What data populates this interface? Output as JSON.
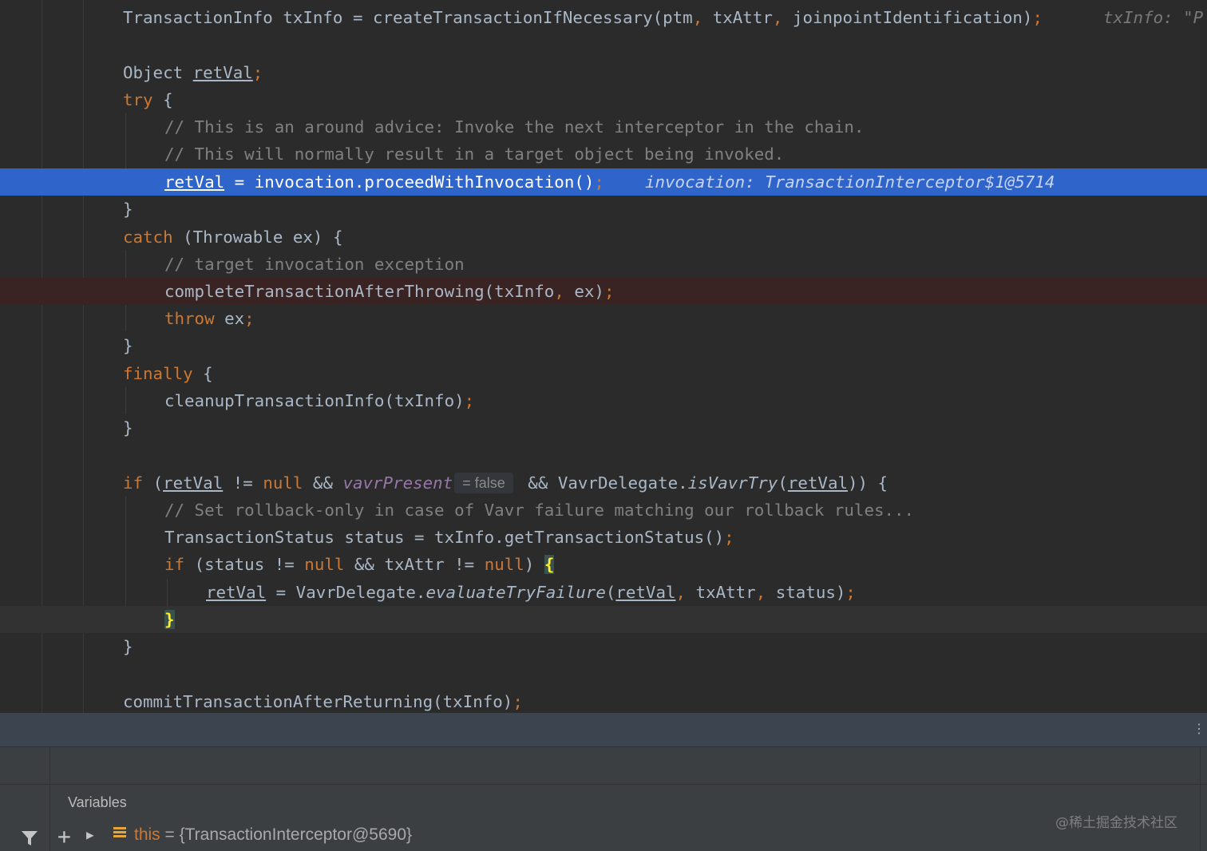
{
  "editor": {
    "line1": {
      "a": "TransactionInfo txInfo = createTransactionIfNecessary(ptm",
      "sep1": ",",
      "b": " txAttr",
      "sep2": ",",
      "c": " joinpointIdentification)",
      "semi": ";",
      "hint": "txInfo: \"P"
    },
    "line2": {
      "a": "Object ",
      "var": "retVal",
      "semi": ";"
    },
    "line3": {
      "kw": "try",
      "rest": " {"
    },
    "line4": {
      "comment": "// This is an around advice: Invoke the next interceptor in the chain."
    },
    "line5": {
      "comment": "// This will normally result in a target object being invoked."
    },
    "line6": {
      "var": "retVal",
      "rest": " = invocation.proceedWithInvocation()",
      "semi": ";",
      "hint": "invocation: TransactionInterceptor$1@5714"
    },
    "line7": {
      "text": "}"
    },
    "line8": {
      "kw": "catch",
      "rest": " (Throwable ex) {"
    },
    "line9": {
      "comment": "// target invocation exception"
    },
    "line10": {
      "a": "completeTransactionAfterThrowing(txInfo",
      "sep": ",",
      "b": " ex)",
      "semi": ";"
    },
    "line11": {
      "kw": "throw",
      "rest": " ex",
      "semi": ";"
    },
    "line12": {
      "text": "}"
    },
    "line13": {
      "kw": "finally",
      "rest": " {"
    },
    "line14": {
      "a": "cleanupTransactionInfo(txInfo)",
      "semi": ";"
    },
    "line15": {
      "text": "}"
    },
    "line16": {
      "kw1": "if",
      "a": " (",
      "var1": "retVal",
      "b": " != ",
      "kw2": "null",
      "c": " && ",
      "field": "vavrPresent",
      "inlay": "= false",
      "d": " && VavrDelegate.",
      "method": "isVavrTry",
      "e": "(",
      "var2": "retVal",
      "f": ")) {"
    },
    "line17": {
      "comment": "// Set rollback-only in case of Vavr failure matching our rollback rules..."
    },
    "line18": {
      "a": "TransactionStatus status = txInfo.getTransactionStatus()",
      "semi": ";"
    },
    "line19": {
      "kw1": "if",
      "a": " (status != ",
      "kw2": "null",
      "b": " && txAttr != ",
      "kw3": "null",
      "c": ") ",
      "brace": "{"
    },
    "line20": {
      "var1": "retVal",
      "a": " = VavrDelegate.",
      "method": "evaluateTryFailure",
      "b": "(",
      "var2": "retVal",
      "sep1": ",",
      "c": " txAttr",
      "sep2": ",",
      "d": " status)",
      "semi": ";"
    },
    "line21": {
      "brace": "}"
    },
    "line22": {
      "text": "}"
    },
    "line23": {
      "a": "commitTransactionAfterReturning(txInfo)",
      "semi": ";"
    }
  },
  "statusbar": {
    "more": "⋮"
  },
  "variables_panel": {
    "title": "Variables",
    "entry": {
      "name": "this",
      "equals": " = ",
      "value": "{TransactionInterceptor@5690}"
    }
  },
  "watermark": "@稀土掘金技术社区",
  "colors": {
    "editor_bg": "#2b2b2b",
    "exec_line": "#2f65ca",
    "breakpoint_line": "#3a2323",
    "keyword": "#cc7832",
    "comment": "#808080",
    "field": "#9876aa"
  }
}
